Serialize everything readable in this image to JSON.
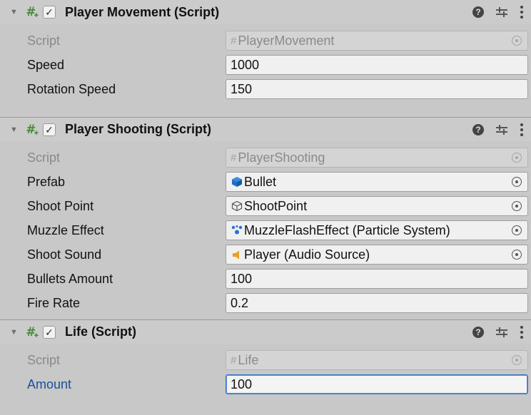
{
  "components": [
    {
      "title": "Player Movement (Script)",
      "fields": [
        {
          "label": "Script",
          "value": "PlayerMovement"
        },
        {
          "label": "Speed",
          "value": "1000"
        },
        {
          "label": "Rotation Speed",
          "value": "150"
        }
      ]
    },
    {
      "title": "Player Shooting (Script)",
      "fields": [
        {
          "label": "Script",
          "value": "PlayerShooting"
        },
        {
          "label": "Prefab",
          "value": "Bullet"
        },
        {
          "label": "Shoot Point",
          "value": "ShootPoint"
        },
        {
          "label": "Muzzle Effect",
          "value": "MuzzleFlashEffect (Particle System)"
        },
        {
          "label": "Shoot Sound",
          "value": "Player (Audio Source)"
        },
        {
          "label": "Bullets Amount",
          "value": "100"
        },
        {
          "label": "Fire Rate",
          "value": "0.2"
        }
      ]
    },
    {
      "title": "Life (Script)",
      "fields": [
        {
          "label": "Script",
          "value": "Life"
        },
        {
          "label": "Amount",
          "value": "100"
        }
      ]
    }
  ],
  "icons": {
    "foldout": "▼",
    "checkbox": "✓",
    "help": "?",
    "hash": "#"
  },
  "colors": {
    "accent_label": "#1a4fa0",
    "active_field_border": "#3a74c4",
    "script_icon": "#4a8a3a",
    "prefab_icon": "#1f74d0",
    "particle_icon": "#2b6fd6",
    "audio_icon": "#e8a020"
  }
}
